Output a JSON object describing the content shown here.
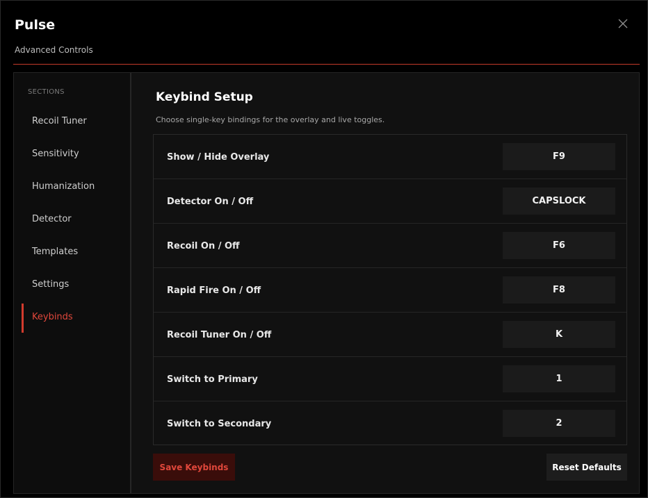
{
  "app": {
    "title": "Pulse",
    "subtitle": "Advanced Controls",
    "close_icon": "close-icon"
  },
  "colors": {
    "accent": "#d23b2d",
    "background": "#000000",
    "panel": "#111111",
    "key_button": "#1b1b1b",
    "save_button_bg": "#3a0d0a"
  },
  "sidebar": {
    "sections_label": "SECTIONS",
    "items": [
      {
        "label": "Recoil Tuner",
        "active": false
      },
      {
        "label": "Sensitivity",
        "active": false
      },
      {
        "label": "Humanization",
        "active": false
      },
      {
        "label": "Detector",
        "active": false
      },
      {
        "label": "Templates",
        "active": false
      },
      {
        "label": "Settings",
        "active": false
      },
      {
        "label": "Keybinds",
        "active": true
      }
    ]
  },
  "main": {
    "title": "Keybind Setup",
    "description": "Choose single-key bindings for the overlay and live toggles.",
    "bindings": [
      {
        "label": "Show / Hide Overlay",
        "key": "F9"
      },
      {
        "label": "Detector On / Off",
        "key": "CAPSLOCK"
      },
      {
        "label": "Recoil On / Off",
        "key": "F6"
      },
      {
        "label": "Rapid Fire On / Off",
        "key": "F8"
      },
      {
        "label": "Recoil Tuner On / Off",
        "key": "K"
      },
      {
        "label": "Switch to Primary",
        "key": "1"
      },
      {
        "label": "Switch to Secondary",
        "key": "2"
      }
    ],
    "save_label": "Save Keybinds",
    "reset_label": "Reset Defaults"
  }
}
